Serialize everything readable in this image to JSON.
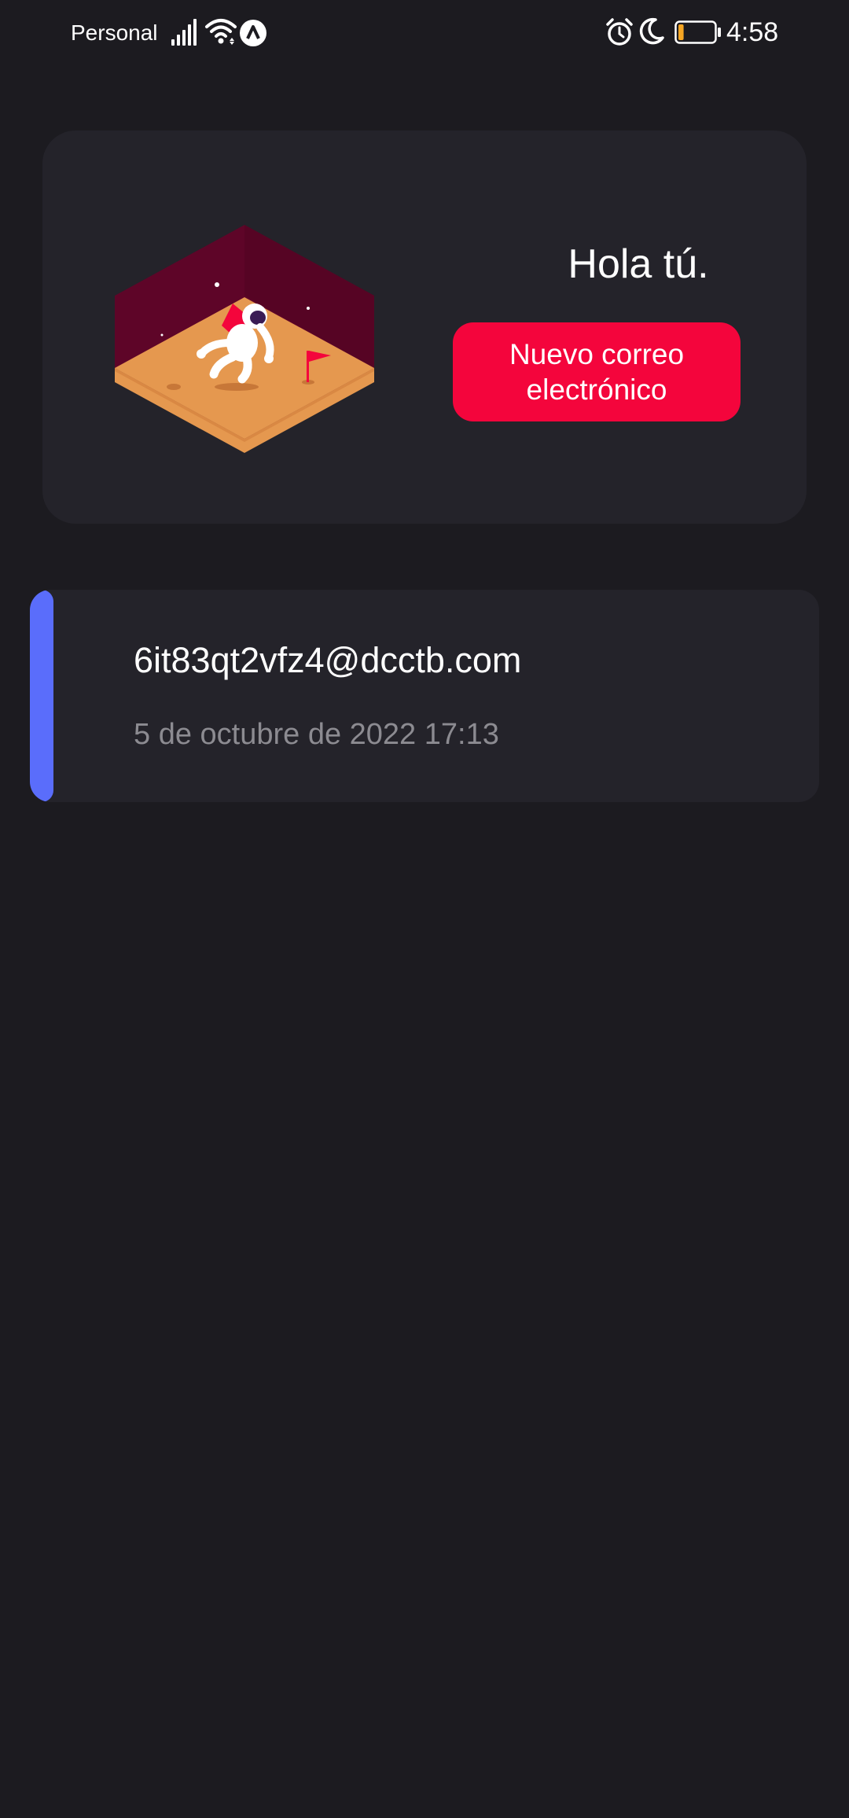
{
  "status_bar": {
    "carrier": "Personal",
    "time": "4:58",
    "icons": [
      "signal-icon",
      "wifi-icon",
      "vpn-icon",
      "alarm-icon",
      "moon-icon",
      "battery-icon"
    ],
    "battery_level_percent": 15,
    "battery_color": "#f5a623"
  },
  "hero": {
    "illustration": "astronaut-on-mars-illustration",
    "greeting": "Hola tú.",
    "new_email_button": "Nuevo correo\nelectrónico",
    "button_color": "#f4053c"
  },
  "emails": [
    {
      "address": "6it83qt2vfz4@dcctb.com",
      "date": "5 de octubre de 2022 17:13",
      "accent_color": "#5a6dfb"
    }
  ]
}
